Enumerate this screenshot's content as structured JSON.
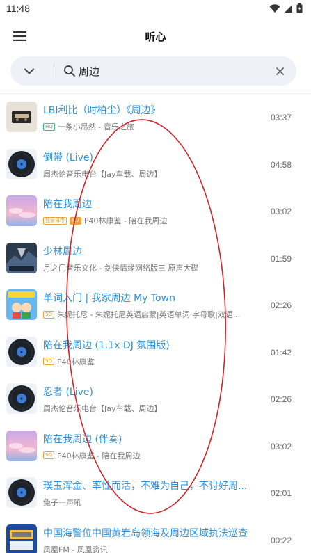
{
  "status_bar": {
    "time": "11:48"
  },
  "app_bar": {
    "title": "听心"
  },
  "search": {
    "query": "周边"
  },
  "results": [
    {
      "title": "LBI利比（时柏尘）《周边》",
      "badges": [
        "HQ"
      ],
      "subtitle": "一条小昂然 - 音乐之旅",
      "duration": "03:37",
      "cover": "cassette"
    },
    {
      "title": "倒带 (Live)",
      "badges": [],
      "subtitle": "周杰伦音乐电台【Jay车载、周边】",
      "duration": "04:58",
      "cover": "vinyl"
    },
    {
      "title": "陪在我周边",
      "badges": [
        "独家母带",
        "MV"
      ],
      "subtitle": "P40林康鉴 - 陪在我周边",
      "duration": "03:02",
      "cover": "pink-sky"
    },
    {
      "title": "少林周边",
      "badges": [],
      "subtitle": "月之门音乐文化 - 剑侠情缘网络版三 原声大碟",
      "duration": "01:59",
      "cover": "dark-art"
    },
    {
      "title": "单词入门 | 我家周边 My Town",
      "badges": [
        "SQ"
      ],
      "subtitle": "朱妮托尼 - 朱妮托尼英语启蒙|英语单词·字母歌|双语...",
      "duration": "02:26",
      "cover": "cartoon"
    },
    {
      "title": "陪在我周边 (1.1x DJ 氛围版)",
      "badges": [
        "SQ"
      ],
      "subtitle": "P40林康鉴",
      "duration": "01:42",
      "cover": "vinyl"
    },
    {
      "title": "忍者 (Live)",
      "badges": [],
      "subtitle": "周杰伦音乐电台【Jay车载、周边】",
      "duration": "02:26",
      "cover": "vinyl"
    },
    {
      "title": "陪在我周边 (伴奏)",
      "badges": [
        "SQ"
      ],
      "subtitle": "P40林康鉴 - 陪在我周边",
      "duration": "03:02",
      "cover": "pink-sky"
    },
    {
      "title": "璞玉浑金、率性而活，不难为自己，不讨好周...",
      "badges": [],
      "subtitle": "兔子一声吼",
      "duration": "02:01",
      "cover": "vinyl"
    },
    {
      "title": "中国海警位中国黄岩岛领海及周边区域执法巡查",
      "badges": [],
      "subtitle": "凤凰FM - 凤凰资讯",
      "duration": "00:22",
      "cover": "news"
    }
  ],
  "colors": {
    "accent": "#2e8fd6",
    "annotation": "#d0222a",
    "search_bg": "#eef2f8"
  },
  "icons": [
    "menu-icon",
    "chevron-down-icon",
    "search-icon",
    "close-icon",
    "wifi-icon",
    "signal-icon",
    "battery-icon"
  ]
}
